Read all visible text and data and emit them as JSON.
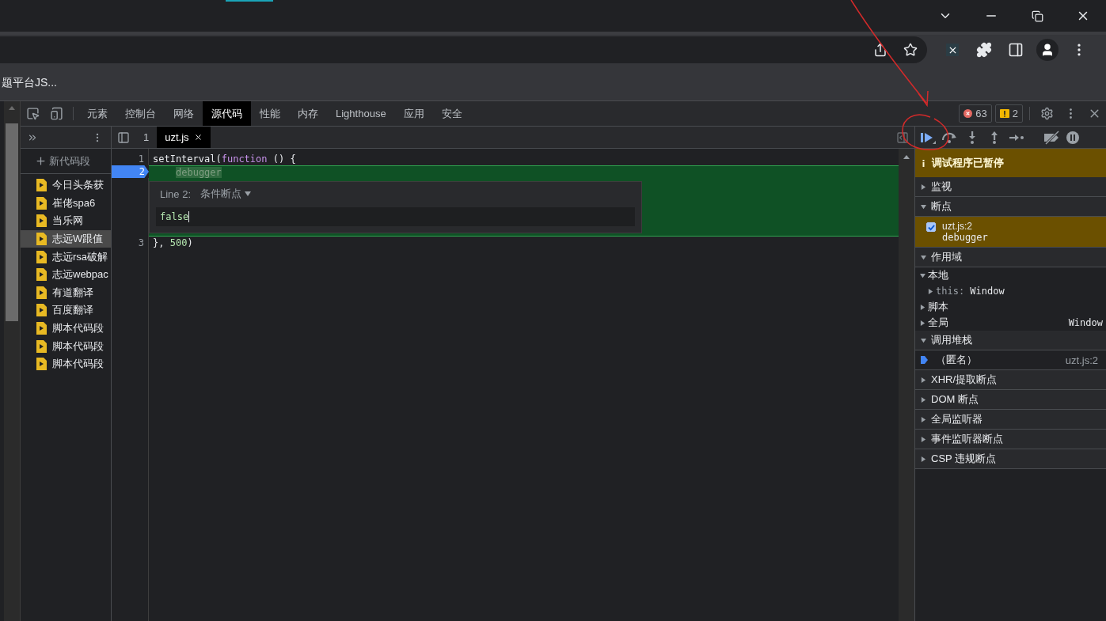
{
  "browser": {
    "bookmark": "题平台JS..."
  },
  "devtools": {
    "tabs": [
      {
        "label": "元素",
        "selected": false
      },
      {
        "label": "控制台",
        "selected": false
      },
      {
        "label": "网络",
        "selected": false
      },
      {
        "label": "源代码",
        "selected": true
      },
      {
        "label": "性能",
        "selected": false
      },
      {
        "label": "内存",
        "selected": false
      },
      {
        "label": "Lighthouse",
        "selected": false
      },
      {
        "label": "应用",
        "selected": false
      },
      {
        "label": "安全",
        "selected": false
      }
    ],
    "error_count": "63",
    "warning_count": "2"
  },
  "navigator": {
    "new_snippet": "新代码段",
    "items": [
      {
        "label": "今日头条获",
        "selected": false
      },
      {
        "label": "崔佬spa6",
        "selected": false
      },
      {
        "label": "当乐网",
        "selected": false
      },
      {
        "label": "志远W跟值",
        "selected": true
      },
      {
        "label": "志远rsa破解",
        "selected": false
      },
      {
        "label": "志远webpac",
        "selected": false
      },
      {
        "label": "有道翻译",
        "selected": false
      },
      {
        "label": "百度翻译",
        "selected": false
      },
      {
        "label": "脚本代码段",
        "selected": false
      },
      {
        "label": "脚本代码段",
        "selected": false
      },
      {
        "label": "脚本代码段",
        "selected": false
      }
    ]
  },
  "editor": {
    "tabs": [
      {
        "label": "1",
        "selected": false,
        "closable": false
      },
      {
        "label": "uzt.js",
        "selected": true,
        "closable": true
      }
    ],
    "lines": [
      {
        "number": "1",
        "paused": false,
        "tokens": [
          {
            "kind": "plain",
            "text": "setInterval("
          },
          {
            "kind": "keyword",
            "text": "function"
          },
          {
            "kind": "plain",
            "text": " () {"
          }
        ]
      },
      {
        "number": "2",
        "paused": true,
        "tokens": [
          {
            "kind": "paused",
            "text": "debugger"
          }
        ]
      },
      {
        "number": "3",
        "paused": false,
        "tokens": [
          {
            "kind": "plain",
            "text": "}, "
          },
          {
            "kind": "number",
            "text": "500"
          },
          {
            "kind": "plain",
            "text": ")"
          }
        ]
      }
    ],
    "condition_popup": {
      "line_label": "Line 2:",
      "type": "条件断点",
      "value": "false"
    }
  },
  "debugger": {
    "paused_message": "调试程序已暂停",
    "panes": [
      {
        "kind": "section",
        "title": "监视",
        "expanded": false
      },
      {
        "kind": "section",
        "title": "断点",
        "expanded": true
      },
      {
        "kind": "breakpoint",
        "file": "uzt.js:2",
        "code": "debugger",
        "checked": true
      },
      {
        "kind": "section",
        "title": "作用域",
        "expanded": true
      },
      {
        "kind": "scope",
        "label": "本地",
        "expanded": true,
        "children": [
          {
            "name": "this:",
            "value": "Window",
            "expanded": false
          }
        ]
      },
      {
        "kind": "scope",
        "label": "脚本",
        "expanded": false
      },
      {
        "kind": "scope",
        "label": "全局",
        "value": "Window",
        "expanded": false
      },
      {
        "kind": "section",
        "title": "调用堆栈",
        "expanded": true
      },
      {
        "kind": "frame",
        "name": "（匿名）",
        "location": "uzt.js:2",
        "selected": true
      },
      {
        "kind": "section",
        "title": "XHR/提取断点",
        "expanded": false
      },
      {
        "kind": "section",
        "title": "DOM 断点",
        "expanded": false
      },
      {
        "kind": "section",
        "title": "全局监听器",
        "expanded": false
      },
      {
        "kind": "section",
        "title": "事件监听器断点",
        "expanded": false
      },
      {
        "kind": "section",
        "title": "CSP 违规断点",
        "expanded": false
      }
    ]
  }
}
